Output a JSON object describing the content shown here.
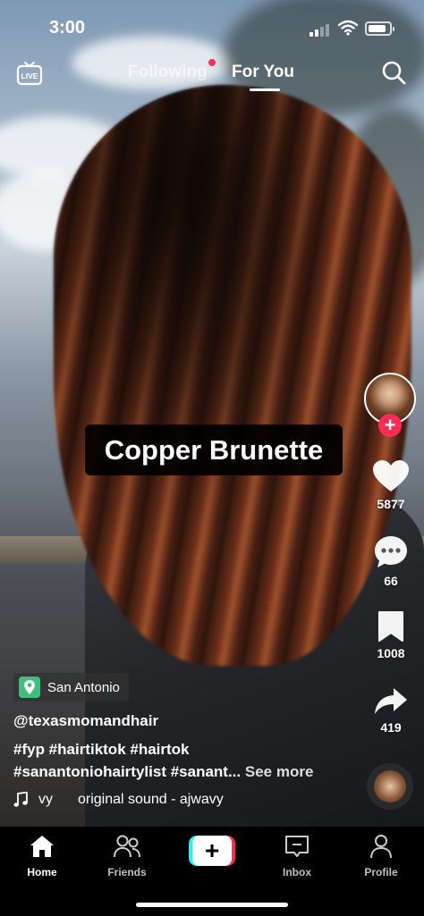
{
  "status_bar": {
    "time": "3:00",
    "battery_level": 0.85
  },
  "top_nav": {
    "live_label": "LIVE",
    "tabs": [
      {
        "label": "Following",
        "active": false,
        "has_dot": true
      },
      {
        "label": "For You",
        "active": true
      }
    ]
  },
  "video": {
    "overlay_text": "Copper Brunette"
  },
  "actions": {
    "likes": "5877",
    "comments": "66",
    "saves": "1008",
    "shares": "419"
  },
  "post": {
    "location": "San Antonio",
    "username": "@texasmomandhair",
    "caption_line1": "#fyp #hairtiktok #hairtok",
    "caption_line2": "#sanantoniohairtylist #sanant...",
    "see_more": "See more",
    "sound_prefix": "vy",
    "sound_title": "original sound - ajwavy"
  },
  "bottom_tabs": [
    {
      "label": "Home",
      "icon": "home-icon",
      "active": true
    },
    {
      "label": "Friends",
      "icon": "friends-icon"
    },
    {
      "label": "Inbox",
      "icon": "inbox-icon"
    },
    {
      "label": "Profile",
      "icon": "profile-icon"
    }
  ],
  "colors": {
    "accent": "#fe2c55",
    "cyan": "#25f4ee",
    "location_green": "#3fbf7a"
  }
}
